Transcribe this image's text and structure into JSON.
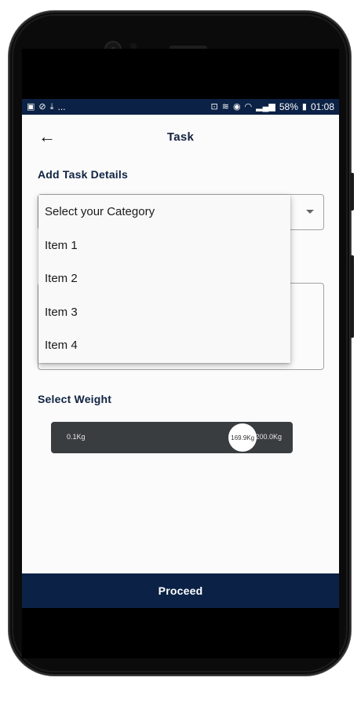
{
  "status": {
    "left_icons": [
      "image-icon",
      "mute-icon",
      "download-icon"
    ],
    "left_ellipsis": "...",
    "battery_pct": "58%",
    "time": "01:08"
  },
  "header": {
    "title": "Task"
  },
  "sections": {
    "details_label": "Add Task Details",
    "weight_label": "Select Weight"
  },
  "category": {
    "placeholder": "Select your Category",
    "options": [
      "Item 1",
      "Item 2",
      "Item 3",
      "Item 4"
    ]
  },
  "weight": {
    "min_label": "0.1Kg",
    "max_label": "200.0Kg",
    "current_label": "169.9Kg",
    "min": 0.1,
    "max": 200.0,
    "value": 169.9
  },
  "footer": {
    "proceed_label": "Proceed"
  },
  "colors": {
    "accent": "#0b2145",
    "slider_track": "#3a3d40"
  }
}
